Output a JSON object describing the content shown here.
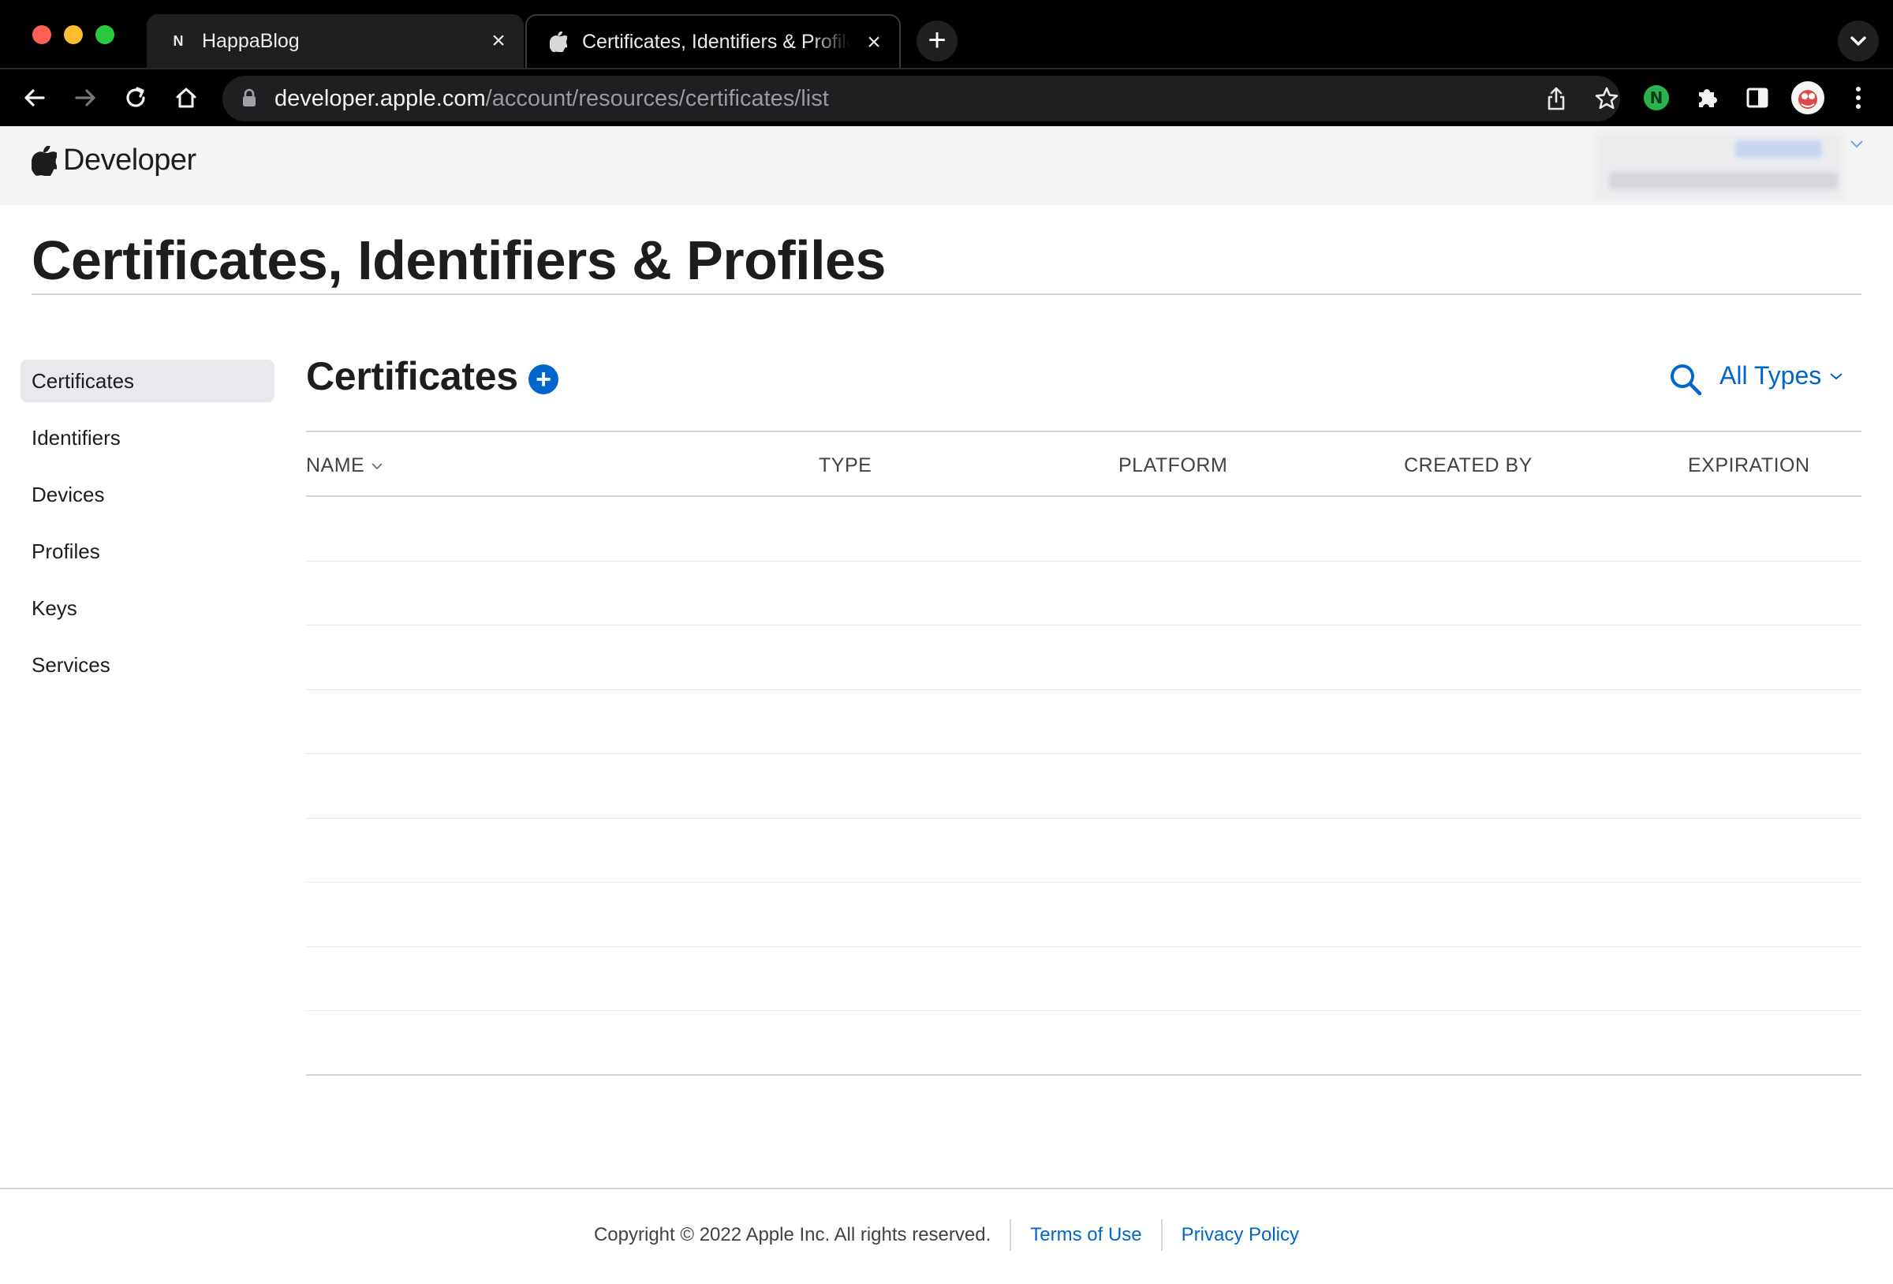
{
  "browser": {
    "tabs": [
      {
        "favicon": "N",
        "title": "HappaBlog",
        "active": false
      },
      {
        "favicon": "apple-logo",
        "title": "Certificates, Identifiers & Profiles",
        "active": true
      }
    ],
    "url_host": "developer.apple.com",
    "url_path": "/account/resources/certificates/list"
  },
  "header": {
    "wordmark": "Developer"
  },
  "page": {
    "title": "Certificates, Identifiers & Profiles"
  },
  "sidebar": {
    "items": [
      {
        "label": "Certificates",
        "selected": true
      },
      {
        "label": "Identifiers",
        "selected": false
      },
      {
        "label": "Devices",
        "selected": false
      },
      {
        "label": "Profiles",
        "selected": false
      },
      {
        "label": "Keys",
        "selected": false
      },
      {
        "label": "Services",
        "selected": false
      }
    ]
  },
  "main": {
    "section_title": "Certificates",
    "filter_label": "All Types",
    "columns": [
      "NAME",
      "TYPE",
      "PLATFORM",
      "CREATED BY",
      "EXPIRATION"
    ],
    "rows": [
      [
        "",
        "",
        "",
        "",
        ""
      ],
      [
        "",
        "",
        "",
        "",
        ""
      ],
      [
        "",
        "",
        "",
        "",
        ""
      ],
      [
        "",
        "",
        "",
        "",
        ""
      ],
      [
        "",
        "",
        "",
        "",
        ""
      ],
      [
        "",
        "",
        "",
        "",
        ""
      ],
      [
        "",
        "",
        "",
        "",
        ""
      ],
      [
        "",
        "",
        "",
        "",
        ""
      ],
      [
        "",
        "",
        "",
        "",
        ""
      ]
    ]
  },
  "footer": {
    "copyright": "Copyright © 2022 Apple Inc. All rights reserved.",
    "terms": "Terms of Use",
    "privacy": "Privacy Policy"
  },
  "colors": {
    "accent": "#0066cc",
    "chrome": "#000000",
    "header_bg": "#f5f5f7"
  }
}
